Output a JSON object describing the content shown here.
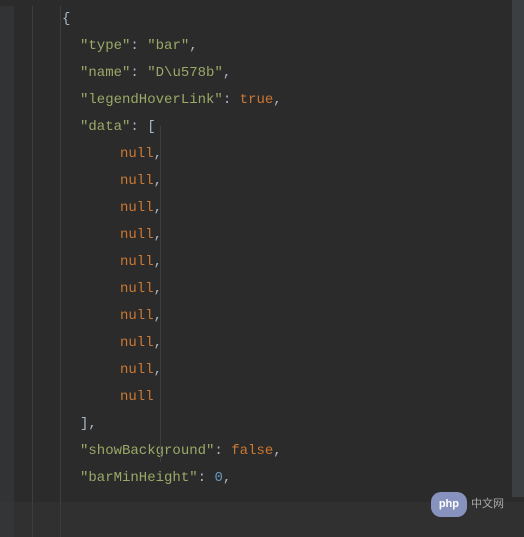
{
  "code": {
    "open_brace": "{",
    "lines": [
      {
        "key": "\"type\"",
        "colon": ": ",
        "value": "\"bar\"",
        "value_type": "string",
        "comma": ","
      },
      {
        "key": "\"name\"",
        "colon": ": ",
        "value": "\"D\\u578b\"",
        "value_type": "string",
        "comma": ","
      },
      {
        "key": "\"legendHoverLink\"",
        "colon": ": ",
        "value": "true",
        "value_type": "keyword-true",
        "comma": ","
      },
      {
        "key": "\"data\"",
        "colon": ": ",
        "value": "[",
        "value_type": "punct",
        "comma": ""
      }
    ],
    "data_items": [
      {
        "value": "null",
        "comma": ","
      },
      {
        "value": "null",
        "comma": ","
      },
      {
        "value": "null",
        "comma": ","
      },
      {
        "value": "null",
        "comma": ","
      },
      {
        "value": "null",
        "comma": ","
      },
      {
        "value": "null",
        "comma": ","
      },
      {
        "value": "null",
        "comma": ","
      },
      {
        "value": "null",
        "comma": ","
      },
      {
        "value": "null",
        "comma": ","
      },
      {
        "value": "null",
        "comma": ""
      }
    ],
    "data_close": "],",
    "trailing_lines": [
      {
        "key": "\"showBackground\"",
        "colon": ": ",
        "value": "false",
        "value_type": "keyword-false",
        "comma": ","
      },
      {
        "key": "\"barMinHeight\"",
        "colon": ": ",
        "value": "0",
        "value_type": "number",
        "comma": ","
      }
    ]
  },
  "watermark": {
    "badge": "php",
    "text": "中文网"
  }
}
